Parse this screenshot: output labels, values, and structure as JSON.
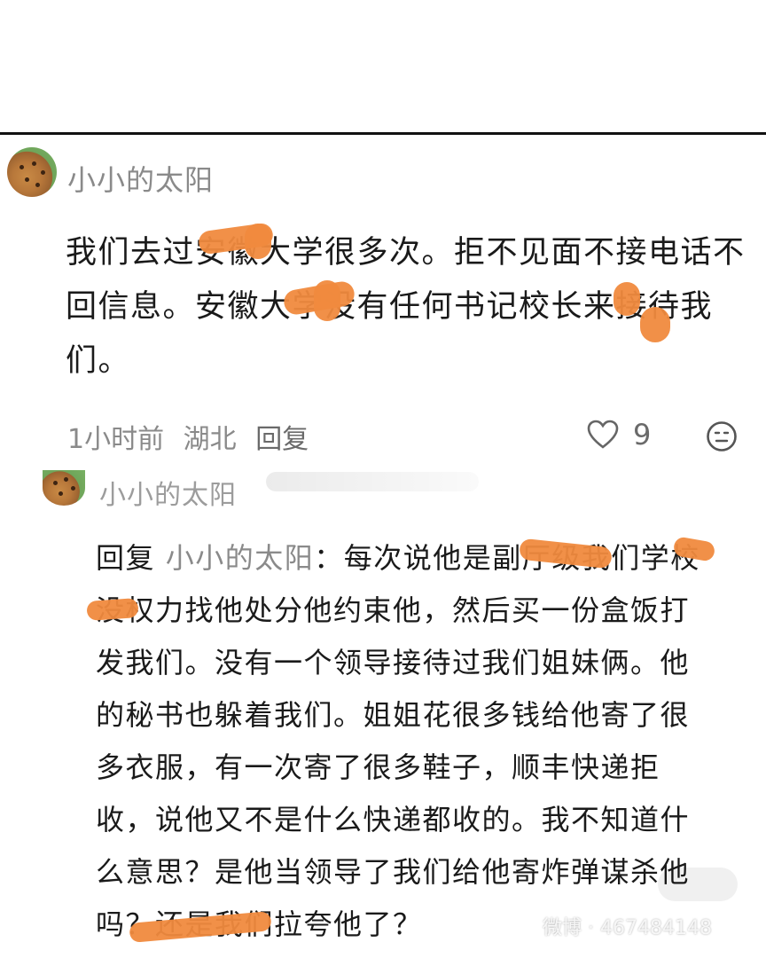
{
  "comment": {
    "username": "小小的太阳",
    "text": "我们去过安徽大学很多次。拒不见面不接电话不回信息。安徽大学没有任何书记校长来接待我们。",
    "time": "1小时前",
    "location": "湖北",
    "reply_label": "回复",
    "like_count": "9"
  },
  "reply": {
    "username": "小小的太阳",
    "prefix": "回复",
    "target": "小小的太阳",
    "text": "：每次说他是副厅级我们学校没权力找他处分他约束他，然后买一份盒饭打发我们。没有一个领导接待过我们姐妹俩。他的秘书也躲着我们。姐姐花很多钱给他寄了很多衣服，有一次寄了很多鞋子，顺丰快递拒收，说他又不是什么快递都收的。我不知道什么意思？是他当领导了我们给他寄炸弹谋杀他吗？还是我们拉夸他了？"
  },
  "watermark": "微博 · 467484148",
  "colors": {
    "redaction": "#f08a3e",
    "meta_gray": "#8a8a8a",
    "text": "#1a1a1a"
  },
  "icons": {
    "like": "heart-outline-icon",
    "emoji": "neutral-face-icon"
  }
}
